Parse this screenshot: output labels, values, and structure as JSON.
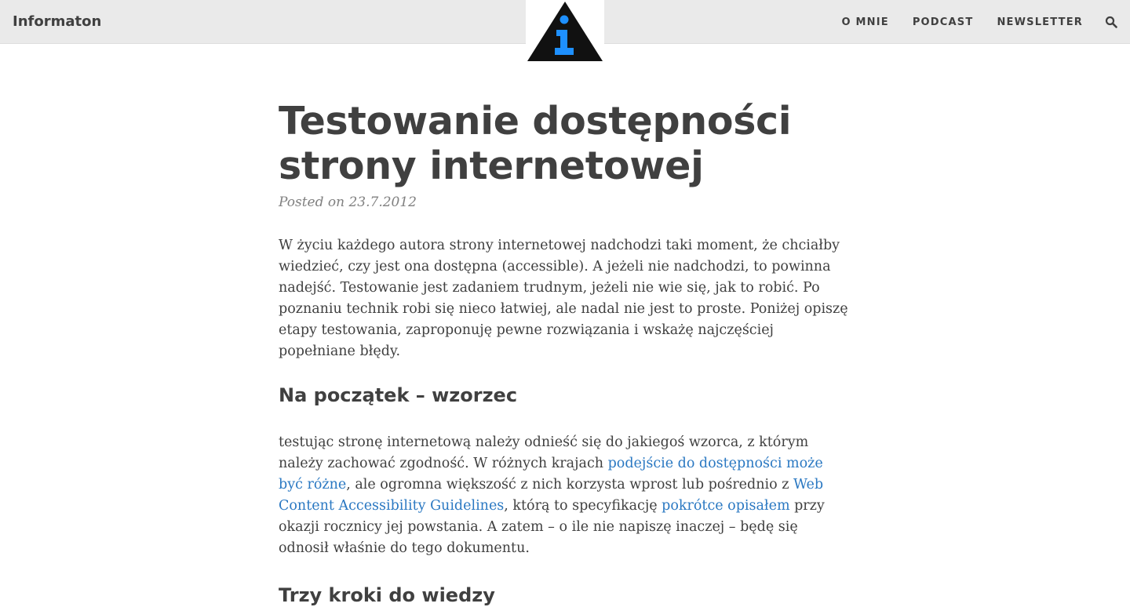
{
  "header": {
    "brand": "Informaton",
    "nav": [
      {
        "label": "O MNIE"
      },
      {
        "label": "PODCAST"
      },
      {
        "label": "NEWSLETTER"
      }
    ],
    "search_icon": "search-icon",
    "logo_icon": "info-triangle-logo"
  },
  "article": {
    "title": "Testowanie dostępności strony internetowej",
    "meta": "Posted on 23.7.2012",
    "intro": "W życiu każdego autora strony internetowej nadchodzi taki moment, że chciałby wiedzieć, czy jest ona dostępna (accessible). A jeżeli nie nadchodzi, to powinna nadejść. Testowanie jest zadaniem trudnym, jeżeli nie wie się, jak to robić. Po poznaniu technik robi się nieco łatwiej, ale nadal nie jest to proste. Poniżej opiszę etapy testowania, zaproponuję pewne rozwiązania i wskażę najczęściej popełniane błędy.",
    "section1": {
      "heading": "Na początek – wzorzec",
      "t1": "testując stronę internetową należy odnieść się do jakiegoś wzorca, z którym należy zachować zgodność. W różnych krajach ",
      "link1": "podejście do dostępności może być różne",
      "t2": ", ale ogromna większość z nich korzysta wprost lub pośrednio z ",
      "link2": "Web Content Accessibility Guidelines",
      "t3": ", którą to specyfikację ",
      "link3": "pokrótce opisałem",
      "t4": " przy okazji rocznicy jej powstania. A zatem – o ile nie napiszę inaczej – będę się odnosił właśnie do tego dokumentu."
    },
    "section2": {
      "heading": "Trzy kroki do wiedzy"
    }
  },
  "colors": {
    "topbar_bg": "#eaeaea",
    "text": "#404040",
    "meta": "#808080",
    "link": "#2a78c2",
    "logo_accent": "#1e90ff"
  }
}
